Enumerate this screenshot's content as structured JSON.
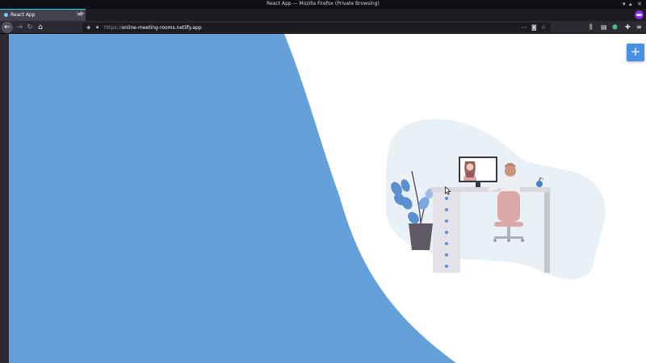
{
  "window": {
    "title": "React App — Mozilla Firefox (Private Browsing)"
  },
  "tabs": [
    {
      "label": "React App",
      "active": true
    }
  ],
  "nav": {
    "url_protocol": "https://",
    "url_host": "online-meeting-rooms.netlify.app"
  },
  "content": {
    "fab_label": "+",
    "colors": {
      "accent_blue": "#64a0da",
      "fab_blue": "#4a90e2",
      "blob": "#e9f0f6",
      "chair_pink": "#dca8a8",
      "pot": "#5f5a66"
    },
    "illustration": "person-at-desk-video-call"
  }
}
